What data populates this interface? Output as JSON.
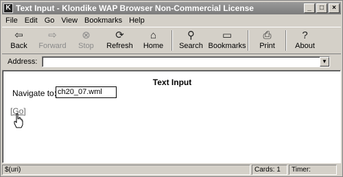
{
  "window": {
    "title": "Text Input - Klondike WAP Browser Non-Commercial License",
    "app_icon": "K"
  },
  "menu": [
    "File",
    "Edit",
    "Go",
    "View",
    "Bookmarks",
    "Help"
  ],
  "toolbar": {
    "back": "Back",
    "forward": "Forward",
    "stop": "Stop",
    "refresh": "Refresh",
    "home": "Home",
    "search": "Search",
    "bookmarks": "Bookmarks",
    "print": "Print",
    "about": "About"
  },
  "address": {
    "label": "Address:",
    "value": ""
  },
  "card": {
    "title": "Text Input",
    "navigate_label": "Navigate to:",
    "navigate_value": "ch20_07.wml",
    "go_link": "[Go]"
  },
  "status": {
    "text": "$(uri)",
    "cards": "Cards: 1",
    "timer": "Timer:"
  }
}
